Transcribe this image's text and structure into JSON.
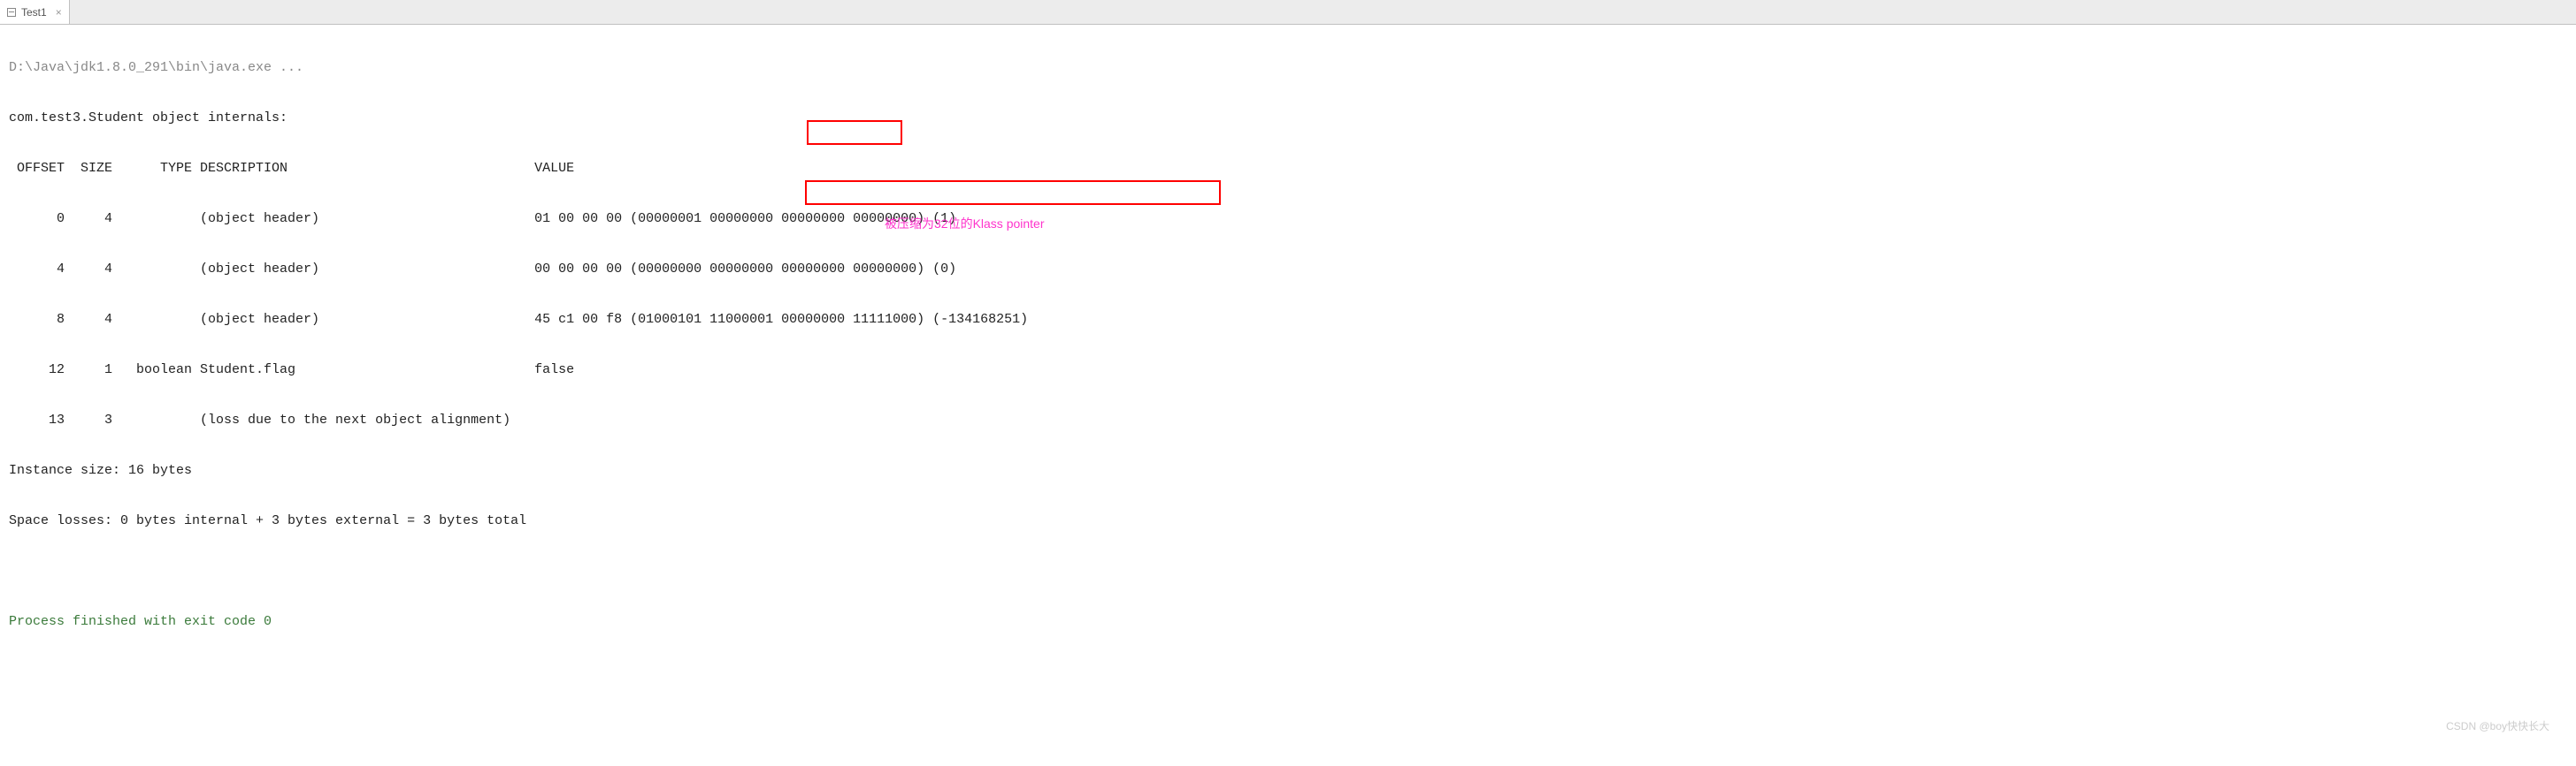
{
  "tab": {
    "label": "Test1",
    "close": "×"
  },
  "console": {
    "exec_line": "D:\\Java\\jdk1.8.0_291\\bin\\java.exe ...",
    "header_line": "com.test3.Student object internals:",
    "columns_line": " OFFSET  SIZE      TYPE DESCRIPTION                               VALUE",
    "row1": "      0     4           (object header)                           01 00 00 00 (00000001 00000000 00000000 00000000) (1)",
    "row2": "      4     4           (object header)                           00 00 00 00 (00000000 00000000 00000000 00000000) (0)",
    "row3": "      8     4           (object header)                           45 c1 00 f8 (01000101 11000001 00000000 11111000) (-134168251)",
    "row4": "     12     1   boolean Student.flag                              false",
    "row5": "     13     3           (loss due to the next object alignment)",
    "instance_size": "Instance size: 16 bytes",
    "space_losses": "Space losses: 0 bytes internal + 3 bytes external = 3 bytes total",
    "blank1": "",
    "blank2": "",
    "exit_line": "Process finished with exit code 0"
  },
  "annotation": "被压缩为32位的Klass pointer",
  "watermark": "CSDN @boy快快长大"
}
